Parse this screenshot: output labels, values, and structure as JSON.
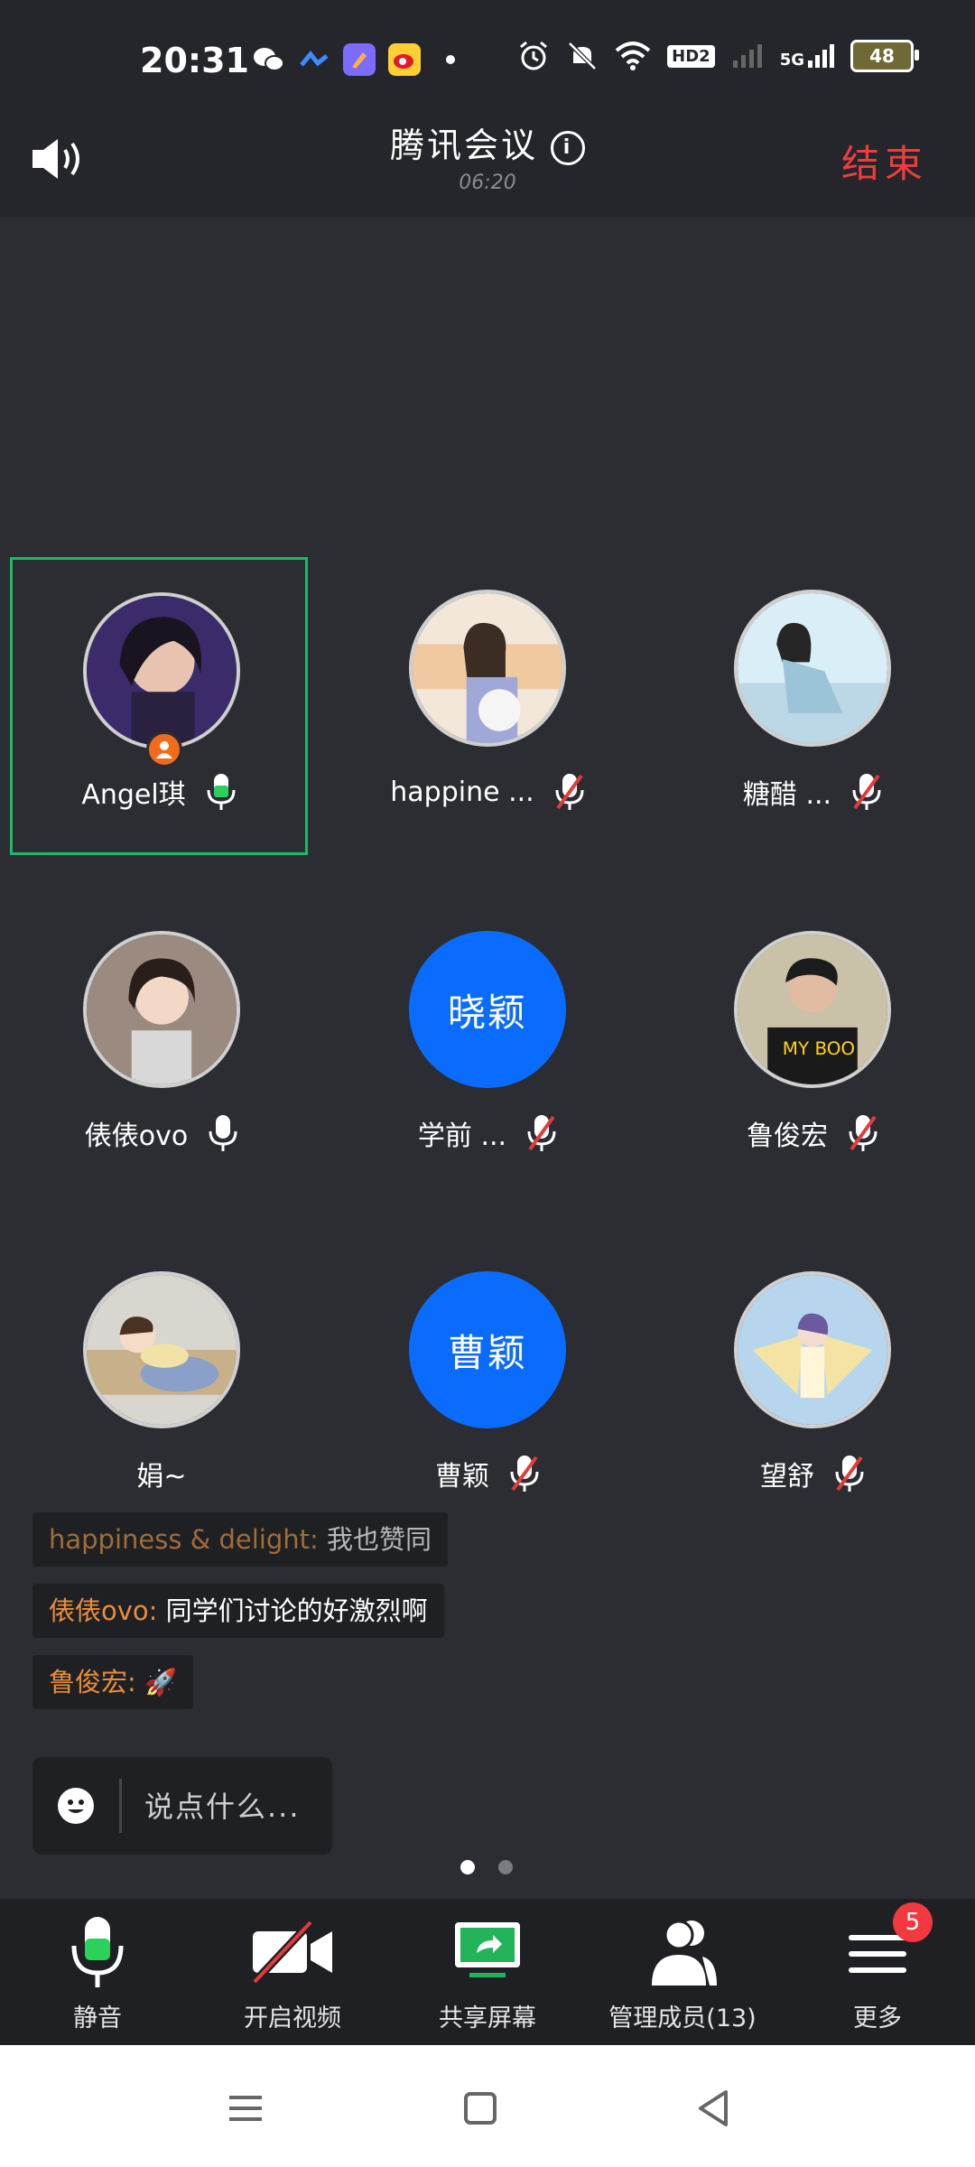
{
  "status_bar": {
    "time": "20:31",
    "icons": [
      "wechat-icon",
      "feishu-icon",
      "app-icon",
      "weibo-icon",
      "dot-icon",
      "alarm-icon",
      "mute-icon",
      "wifi-icon",
      "hd-icon",
      "signal-icon",
      "5g-signal-icon"
    ],
    "hd_label": "HD2",
    "network_label": "5G",
    "battery_level": "48"
  },
  "header": {
    "title": "腾讯会议",
    "timer": "06:20",
    "end_label": "结束"
  },
  "participants": [
    {
      "name": "Angel琪",
      "mic": "speaking",
      "host": true,
      "avatar": "photo"
    },
    {
      "name": "happine ...",
      "mic": "muted",
      "avatar": "photo"
    },
    {
      "name": "糖醋 ...",
      "mic": "muted",
      "avatar": "photo"
    },
    {
      "name": "俵俵ovo",
      "mic": "on",
      "avatar": "photo"
    },
    {
      "name": "学前 ...",
      "mic": "muted",
      "avatar_text": "晓颖"
    },
    {
      "name": "鲁俊宏",
      "mic": "muted",
      "avatar": "photo"
    },
    {
      "name": "娟~",
      "mic": "none",
      "avatar": "photo"
    },
    {
      "name": "曹颖",
      "mic": "muted",
      "avatar_text": "曹颖"
    },
    {
      "name": "望舒",
      "mic": "muted",
      "avatar": "photo"
    }
  ],
  "chat": [
    {
      "author": "happiness & delight:",
      "text": " 我也赞同"
    },
    {
      "author": "俵俵ovo:",
      "text": " 同学们讨论的好激烈啊"
    },
    {
      "author": "鲁俊宏:",
      "text": " 🚀"
    }
  ],
  "chat_input": {
    "placeholder": "说点什么..."
  },
  "pager": {
    "pages": 2,
    "current": 1
  },
  "toolbar": {
    "mute_label": "静音",
    "video_label": "开启视频",
    "share_label": "共享屏幕",
    "members_label": "管理成员(13)",
    "more_label": "更多",
    "more_badge": "5"
  },
  "colors": {
    "accent_blue": "#0a6cff",
    "end_red": "#ef3d3d",
    "active_green": "#1fb865",
    "host_orange": "#f26b1d"
  }
}
